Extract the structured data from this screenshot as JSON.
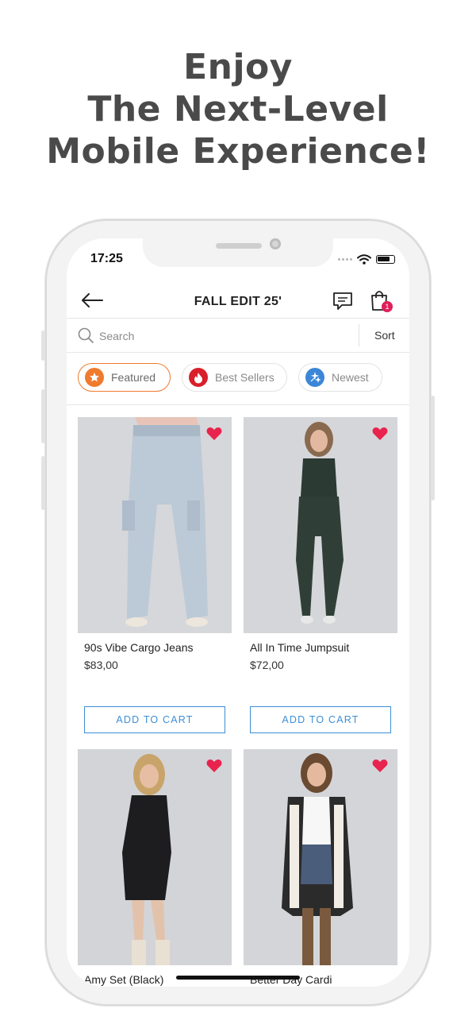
{
  "headline": [
    "Enjoy",
    "The Next-Level",
    "Mobile Experience!"
  ],
  "status_bar": {
    "time": "17:25"
  },
  "header": {
    "title": "FALL EDIT 25'",
    "cart_count": "1"
  },
  "search": {
    "placeholder": "Search",
    "sort_label": "Sort"
  },
  "filters": [
    {
      "label": "Featured",
      "icon": "star-icon",
      "color": "#f07a2e",
      "active": true
    },
    {
      "label": "Best Sellers",
      "icon": "flame-icon",
      "color": "#d81f2a",
      "active": false
    },
    {
      "label": "Newest",
      "icon": "sparkle-icon",
      "color": "#3b86d8",
      "active": false
    }
  ],
  "products": [
    {
      "name": "90s Vibe Cargo Jeans",
      "price": "$83,00",
      "button": "ADD TO CART"
    },
    {
      "name": "All In Time Jumpsuit",
      "price": "$72,00",
      "button": "ADD TO CART"
    },
    {
      "name": "Amy Set (Black)",
      "price": "",
      "button": ""
    },
    {
      "name": "Better Day Cardi",
      "price": "",
      "button": ""
    }
  ],
  "colors": {
    "accent": "#3d8fd6",
    "heart": "#e8234d",
    "badge": "#e01f5b",
    "headline": "#4a4a4a"
  }
}
